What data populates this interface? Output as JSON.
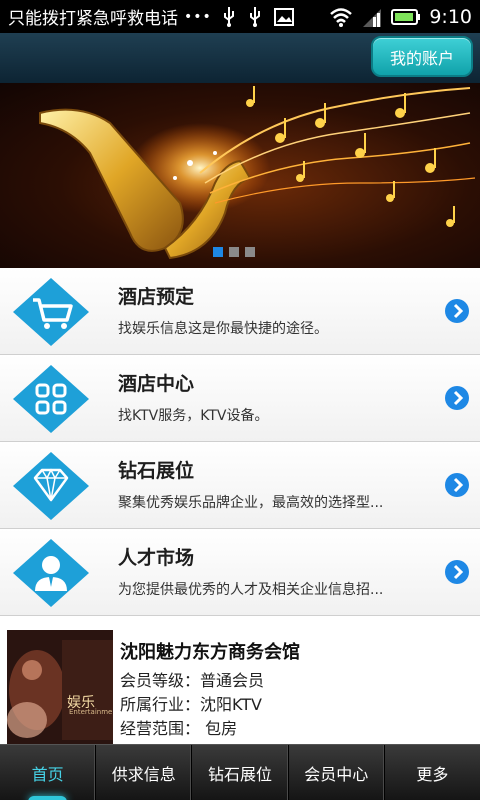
{
  "statusbar": {
    "carrier_text": "只能拨打紧急呼救电话",
    "overflow": "•••",
    "battery": "",
    "time": "9:10"
  },
  "header": {
    "account_label": "我的账户"
  },
  "banner": {
    "slides": 3,
    "active_slide": 1
  },
  "services": [
    {
      "title": "酒店预定",
      "subtitle": "找娱乐信息这是你最快捷的途径。",
      "icon": "cart-icon"
    },
    {
      "title": "酒店中心",
      "subtitle": "找KTV服务，KTV设备。",
      "icon": "apps-grid-icon"
    },
    {
      "title": "钻石展位",
      "subtitle": "聚集优秀娱乐品牌企业，最高效的选择型...",
      "icon": "diamond-icon"
    },
    {
      "title": "人才市场",
      "subtitle": "为您提供最优秀的人才及相关企业信息招...",
      "icon": "person-icon"
    }
  ],
  "company": {
    "name": "沈阳魅力东方商务会馆",
    "member_level": "会员等级：普通会员",
    "industry": "所属行业：沈阳KTV",
    "scope": "经营范围： 包房",
    "image_text": "娱乐",
    "image_subtext": "Entertainment"
  },
  "tabs": [
    {
      "label": "首页",
      "active": true
    },
    {
      "label": "供求信息",
      "active": false
    },
    {
      "label": "钻石展位",
      "active": false
    },
    {
      "label": "会员中心",
      "active": false
    },
    {
      "label": "更多",
      "active": false
    }
  ],
  "colors": {
    "accent": "#1ea0d8",
    "button": "#1bb6bf",
    "tab_active": "#46d2e6"
  }
}
